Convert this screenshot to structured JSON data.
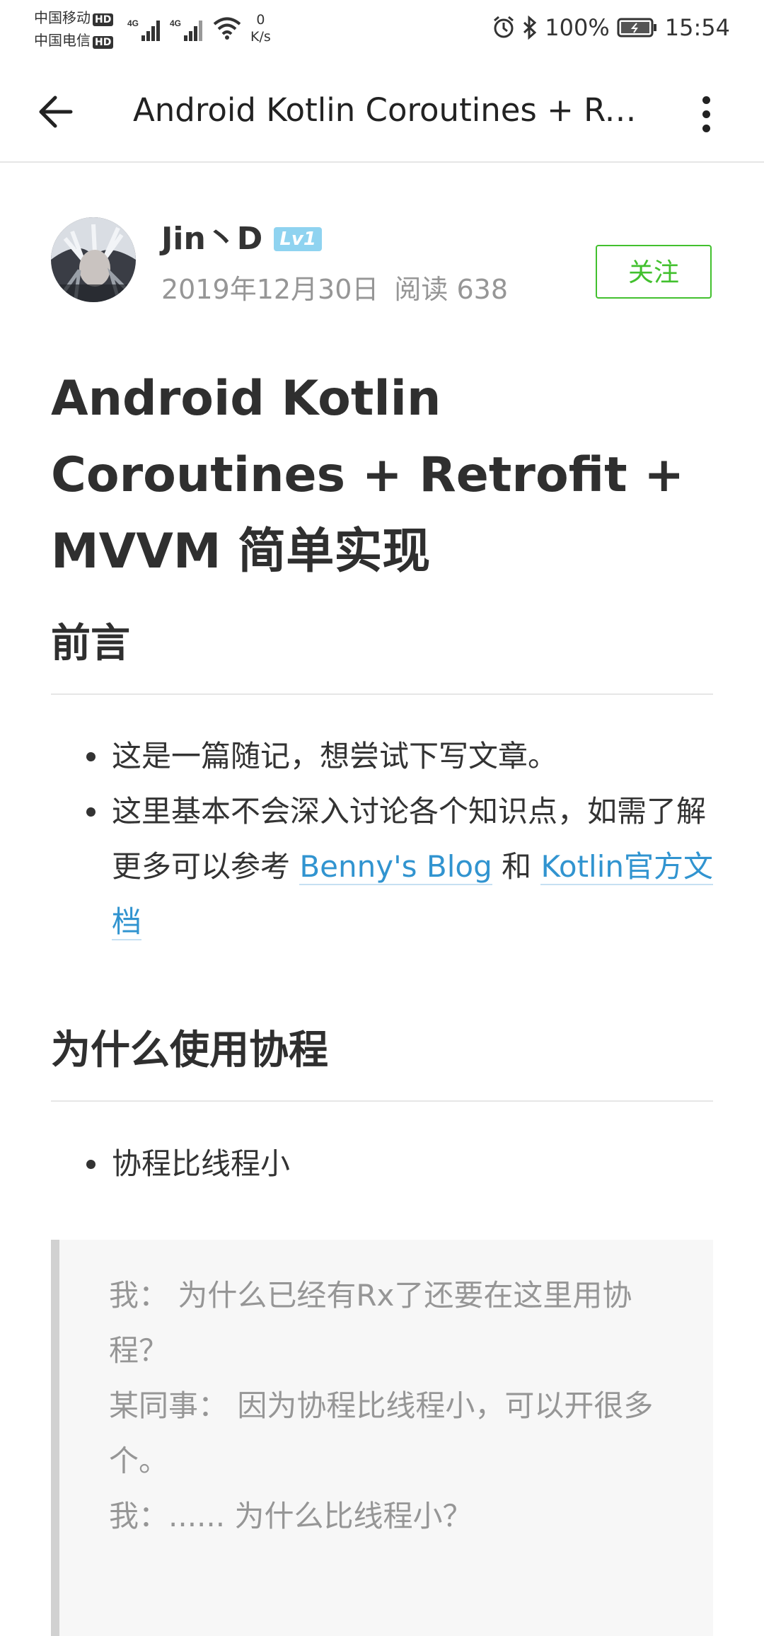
{
  "status_bar": {
    "carrier1": "中国移动",
    "carrier2": "中国电信",
    "hd": "HD",
    "net1": "4G",
    "net2": "4G",
    "speed_value": "0",
    "speed_unit": "K/s",
    "battery": "100%",
    "time": "15:54"
  },
  "app_bar": {
    "title": "Android Kotlin Coroutines + Retrofit + MVVM 简单实现"
  },
  "author": {
    "name": "Jin丶D",
    "level": "Lv1",
    "date": "2019年12月30日",
    "reads": "阅读 638",
    "follow_label": "关注"
  },
  "article": {
    "title": "Android Kotlin Coroutines + Retrofit + MVVM 简单实现",
    "section1": {
      "heading": "前言",
      "bullet1": "这是一篇随记，想尝试下写文章。",
      "bullet2_prefix": "这里基本不会深入讨论各个知识点，如需了解更多可以参考 ",
      "link1": "Benny's Blog",
      "bullet2_mid": " 和 ",
      "link2": "Kotlin官方文档"
    },
    "section2": {
      "heading": "为什么使用协程",
      "bullet1": "协程比线程小"
    },
    "quote": {
      "line1": "我： 为什么已经有Rx了还要在这里用协程？",
      "line2": "某同事： 因为协程比线程小，可以开很多个。",
      "line3": "我：...... 为什么比线程小？"
    }
  }
}
